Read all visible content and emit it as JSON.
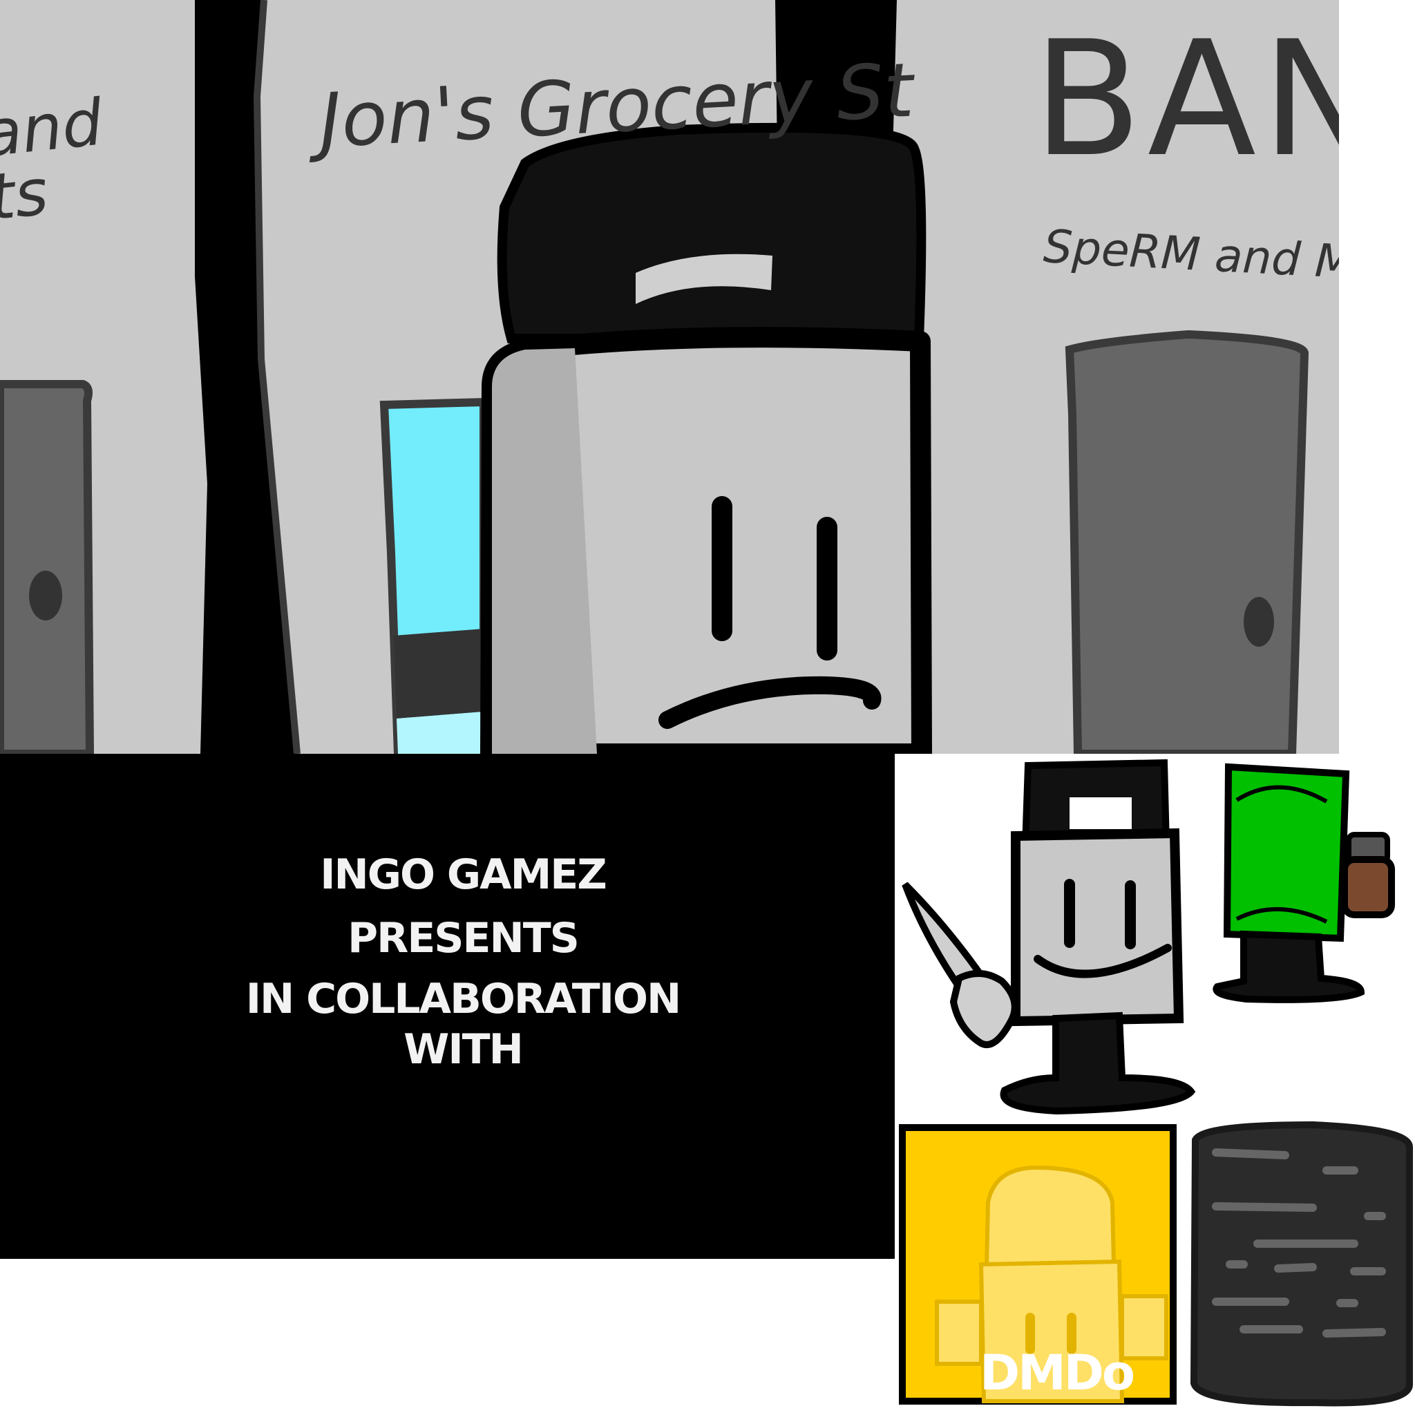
{
  "scene": {
    "store_sign_left": "and\nts",
    "store_sign_middle": "Jon's Grocery St",
    "bank_sign_title": "BANK",
    "bank_sign_subtitle": "SpeRM and Money",
    "colors": {
      "wall": "#c9c9c9",
      "door": "#666666",
      "window": "#73ecfb",
      "pillar": "#000000",
      "character_body": "#c8c8c8",
      "character_hat": "#111111"
    }
  },
  "intro_card": {
    "lines": [
      "INGO GAMEZ",
      "PRESENTS",
      "IN COLLABORATION",
      "WITH"
    ]
  },
  "sprites": {
    "logo_label": "DMDo",
    "colors": {
      "logo_bg": "#ffcc00",
      "green_character": "#00c000",
      "rock": "#2b2b2b"
    }
  }
}
